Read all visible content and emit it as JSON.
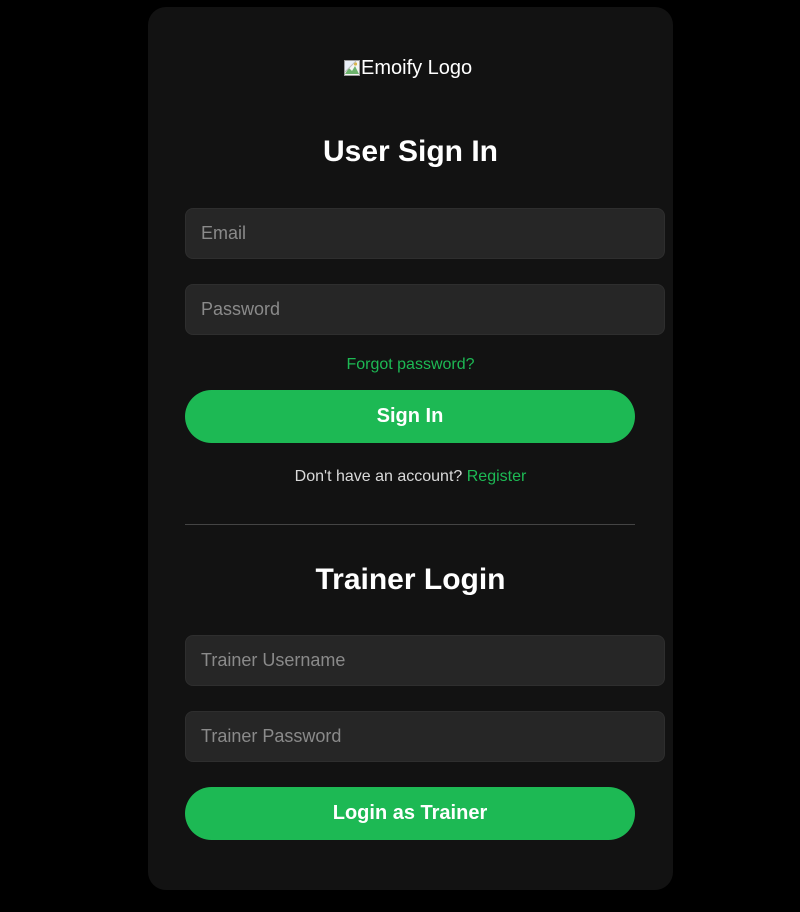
{
  "logo": {
    "alt_text": "Emoify Logo",
    "icon": "broken-image-icon"
  },
  "user_signin": {
    "title": "User Sign In",
    "email_placeholder": "Email",
    "password_placeholder": "Password",
    "forgot_password": "Forgot password?",
    "submit_label": "Sign In",
    "no_account_text": "Don't have an account?",
    "register_link": "Register"
  },
  "trainer_login": {
    "title": "Trainer Login",
    "username_placeholder": "Trainer Username",
    "password_placeholder": "Trainer Password",
    "submit_label": "Login as Trainer"
  },
  "colors": {
    "background": "#000000",
    "card": "#121212",
    "input": "#262626",
    "accent": "#1db954",
    "text": "#ffffff"
  }
}
